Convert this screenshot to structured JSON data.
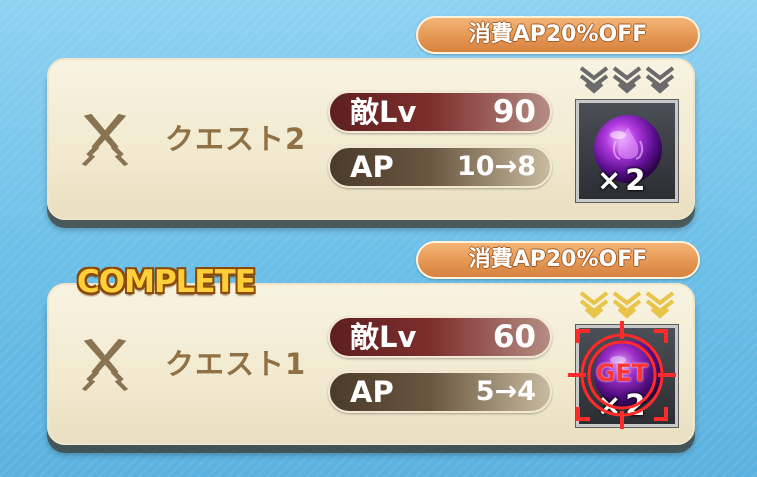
{
  "quests": [
    {
      "name": "クエスト2",
      "discount_label": "消費AP20%OFF",
      "enemy_level_label": "敵Lv",
      "enemy_level": "90",
      "ap_label": "AP",
      "ap_value": "10→8",
      "reward_count": "×2",
      "difficulty_chevrons": 3,
      "chevron_color": "#6b6b6b",
      "completed": false
    },
    {
      "name": "クエスト1",
      "discount_label": "消費AP20%OFF",
      "enemy_level_label": "敵Lv",
      "enemy_level": "60",
      "ap_label": "AP",
      "ap_value": "5→4",
      "reward_count": "×2",
      "difficulty_chevrons": 3,
      "chevron_color": "#e8c44a",
      "completed": true,
      "complete_label": "COMPLETE",
      "reward_status": "GET"
    }
  ],
  "icons": {
    "quest": "crossed-swords-icon",
    "reward": "purple-orb-icon",
    "difficulty": "chevron-down-icon"
  }
}
